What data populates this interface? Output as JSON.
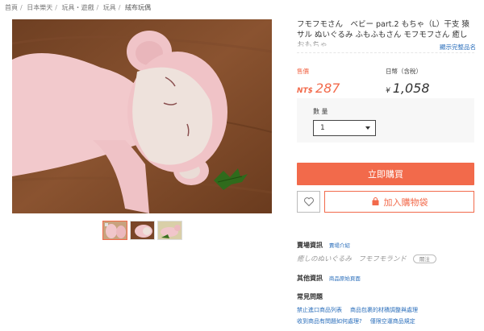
{
  "breadcrumb": [
    "首頁",
    "日本樂天",
    "玩具・遊戲",
    "玩具",
    "絨布玩偶"
  ],
  "product": {
    "title": "フモフモさん　ベビー part.2 もちゃ（L）干支 猿 サル ぬいぐるみ ふもふもさん モフモフさん 癒し おもちゃ",
    "expand_label": "顯示完整品名"
  },
  "price": {
    "label_twd": "售價",
    "currency_twd": "NT$",
    "value_twd": "287",
    "label_jpy": "日幣（含稅）",
    "currency_jpy": "¥",
    "value_jpy": "1,058"
  },
  "quantity": {
    "label": "數 量",
    "selected": "1"
  },
  "actions": {
    "buy_now": "立即購買",
    "add_to_cart": "加入購物袋"
  },
  "seller": {
    "label": "賣場資訊",
    "intro_link": "賣場介紹",
    "shop_name": "癒しのぬいぐるみ　フモフモランド",
    "follow": "關注"
  },
  "other": {
    "label": "其他資訊",
    "link": "商品原始頁面"
  },
  "faq": {
    "title": "常見問題",
    "links": [
      [
        "禁止進口商品列表",
        "商品包裹的材積調整與處理"
      ],
      [
        "收到商品有問題如何處理?",
        "僅限空運商品規定"
      ]
    ]
  },
  "colors": {
    "accent": "#f26a4b",
    "link": "#2a6ebb"
  }
}
